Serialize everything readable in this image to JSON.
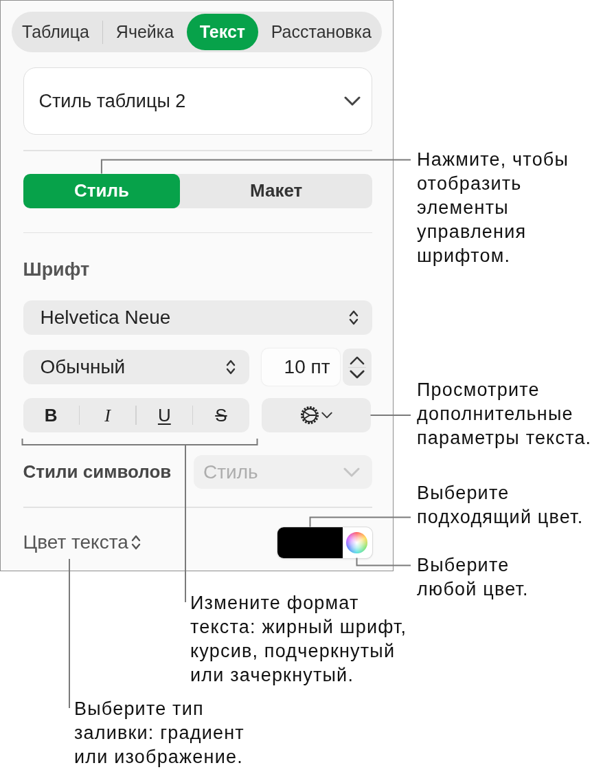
{
  "inspector": {
    "tabs": [
      {
        "label": "Таблица",
        "selected": false
      },
      {
        "label": "Ячейка",
        "selected": false
      },
      {
        "label": "Текст",
        "selected": true
      },
      {
        "label": "Расстановка",
        "selected": false
      }
    ],
    "table_style": {
      "value": "Стиль таблицы 2"
    },
    "mode_tabs": [
      {
        "label": "Стиль",
        "selected": true
      },
      {
        "label": "Макет",
        "selected": false
      }
    ],
    "font": {
      "heading": "Шрифт",
      "family": "Helvetica Neue",
      "typeface": "Обычный",
      "size": "10 пт",
      "format_buttons": [
        {
          "kind": "bold",
          "label": "B"
        },
        {
          "kind": "italic",
          "label": "I"
        },
        {
          "kind": "underline",
          "label": "U"
        },
        {
          "kind": "strikethrough",
          "label": "S"
        }
      ]
    },
    "character_styles": {
      "label": "Стили символов",
      "value": "Стиль",
      "disabled": true
    },
    "text_color": {
      "label": "Цвет текста",
      "color": "#000000"
    }
  },
  "callouts": [
    {
      "text": "Нажмите, чтобы отобразить элементы управления шрифтом."
    },
    {
      "text": "Просмотрите дополнительные параметры текста."
    },
    {
      "text": "Выберите подходящий цвет."
    },
    {
      "text": "Выберите любой цвет."
    },
    {
      "text": "Измените формат текста: жирный шрифт, курсив, подчеркнутый или зачеркнутый."
    },
    {
      "text": "Выберите тип заливки: градиент или изображение."
    }
  ]
}
